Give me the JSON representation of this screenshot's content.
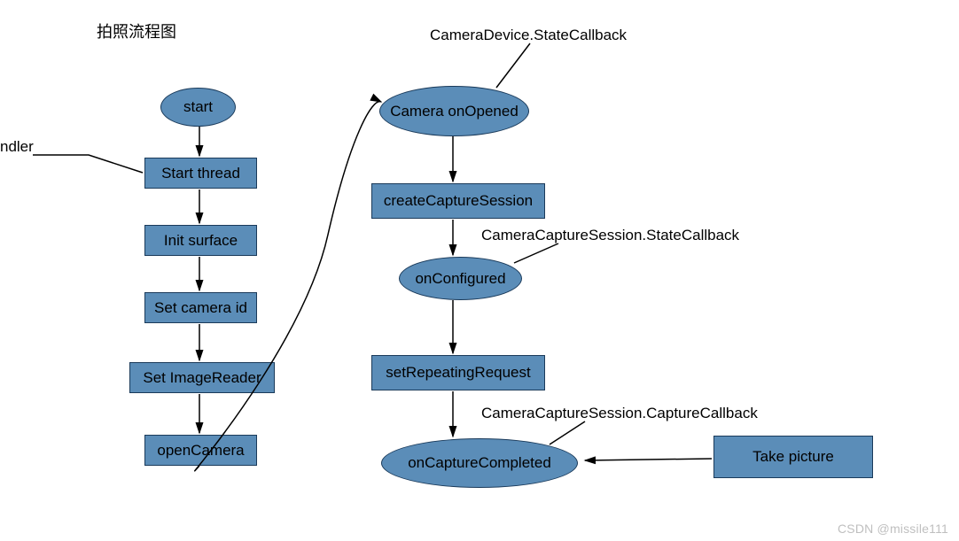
{
  "title": "拍照流程图",
  "sideLabel": "ndler",
  "left": {
    "start": "start",
    "startThread": "Start thread",
    "initSurface": "Init surface",
    "setCameraId": "Set camera id",
    "setImageReader": "Set ImageReader",
    "openCamera": "openCamera"
  },
  "right": {
    "cameraOnOpened": "Camera onOpened",
    "createCaptureSession": "createCaptureSession",
    "onConfigured": "onConfigured",
    "setRepeatingRequest": "setRepeatingRequest",
    "onCaptureCompleted": "onCaptureCompleted",
    "takePicture": "Take picture"
  },
  "annotations": {
    "deviceStateCb": "CameraDevice.StateCallback",
    "sessionStateCb": "CameraCaptureSession.StateCallback",
    "captureCb": "CameraCaptureSession.CaptureCallback"
  },
  "watermark": "CSDN @missile111"
}
